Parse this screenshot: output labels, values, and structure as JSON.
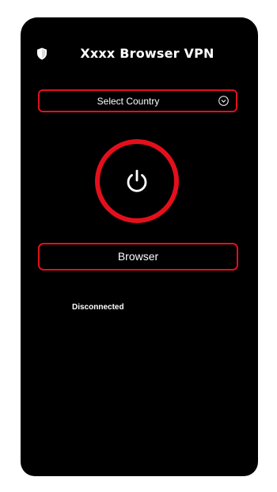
{
  "app": {
    "title": "Xxxx Browser VPN",
    "header_icon": "shield-icon"
  },
  "country_select": {
    "label": "Select Country",
    "icon": "chevron-down-icon"
  },
  "connect": {
    "icon": "power-icon"
  },
  "browser_button": {
    "label": "Browser"
  },
  "status": {
    "text": "Disconnected"
  },
  "colors": {
    "background": "#000000",
    "accent": "#e3101c",
    "text": "#ffffff"
  }
}
